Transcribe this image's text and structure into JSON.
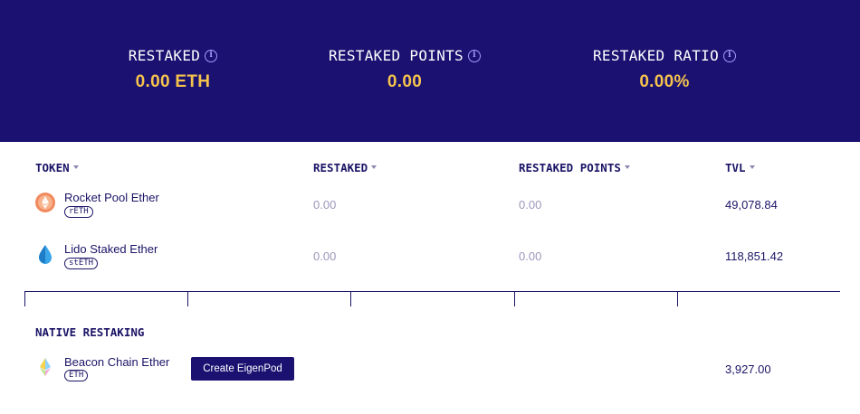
{
  "stats": [
    {
      "label": "RESTAKED",
      "value": "0.00 ETH"
    },
    {
      "label": "RESTAKED POINTS",
      "value": "0.00"
    },
    {
      "label": "RESTAKED RATIO",
      "value": "0.00%"
    }
  ],
  "table": {
    "columns": [
      "TOKEN",
      "RESTAKED",
      "RESTAKED POINTS",
      "TVL"
    ],
    "rows": [
      {
        "name": "Rocket Pool Ether",
        "symbol": "rETH",
        "icon": "rocket-pool-ether-icon",
        "restaked": "0.00",
        "points": "0.00",
        "tvl": "49,078.84"
      },
      {
        "name": "Lido Staked Ether",
        "symbol": "stETH",
        "icon": "lido-staked-ether-icon",
        "restaked": "0.00",
        "points": "0.00",
        "tvl": "118,851.42"
      }
    ]
  },
  "native": {
    "title": "NATIVE RESTAKING",
    "row": {
      "name": "Beacon Chain Ether",
      "symbol": "ETH",
      "icon": "beacon-chain-ether-icon",
      "button": "Create EigenPod",
      "tvl": "3,927.00"
    }
  },
  "colors": {
    "hero_bg": "#1a1171",
    "stat_value": "#f5c34d",
    "text_primary": "#1a1466",
    "text_muted": "#9b97bc",
    "info_icon": "#a79bff"
  }
}
